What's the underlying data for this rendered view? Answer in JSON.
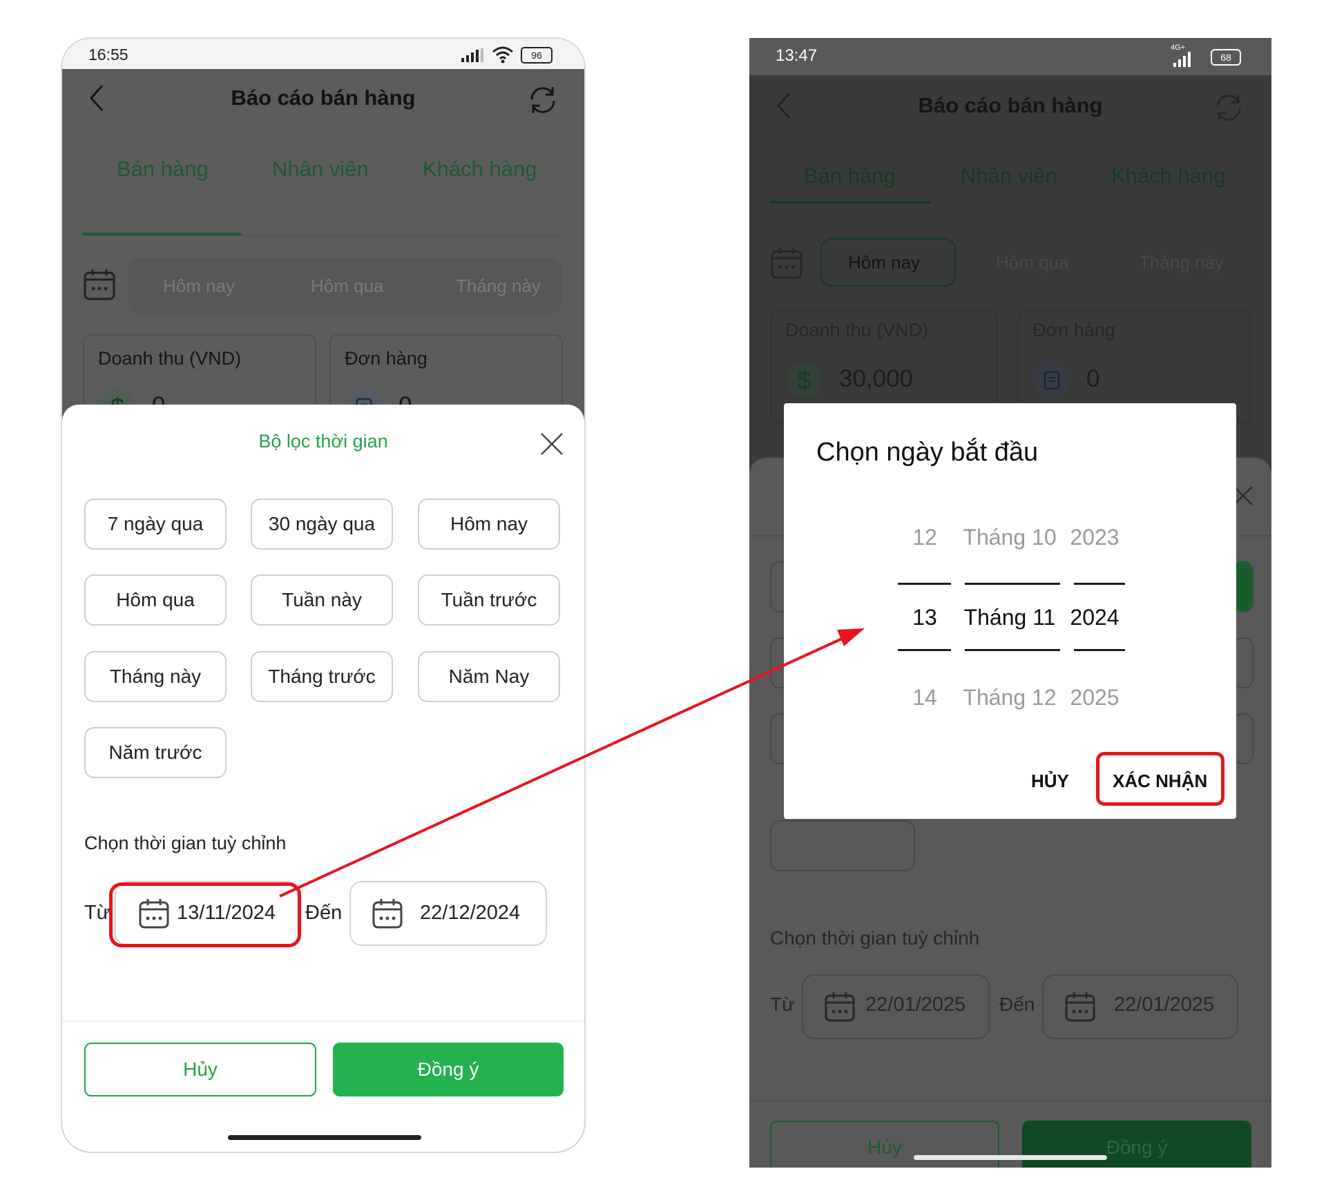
{
  "left_screen": {
    "status_bar": {
      "time": "16:55",
      "battery": "96"
    },
    "header": {
      "title": "Báo cáo bán hàng"
    },
    "tabs": [
      "Bán hàng",
      "Nhân viên",
      "Khách hàng"
    ],
    "quick_chips": [
      "Hôm nay",
      "Hôm qua",
      "Tháng này"
    ],
    "cards": [
      {
        "label": "Doanh thu (VND)",
        "value": "0"
      },
      {
        "label": "Đơn hàng",
        "value": "0"
      }
    ],
    "filter_sheet": {
      "title": "Bộ lọc thời gian",
      "presets": [
        "7 ngày qua",
        "30 ngày qua",
        "Hôm nay",
        "Hôm qua",
        "Tuần này",
        "Tuần trước",
        "Tháng này",
        "Tháng trước",
        "Năm Nay",
        "Năm trước"
      ],
      "custom_label": "Chọn thời gian tuỳ chỉnh",
      "from_label": "Từ",
      "from_date": "13/11/2024",
      "to_label": "Đến",
      "to_date": "22/12/2024",
      "cancel_label": "Hủy",
      "confirm_label": "Đồng ý"
    }
  },
  "right_screen": {
    "status_bar": {
      "time": "13:47",
      "battery": "68",
      "network": "4G+"
    },
    "header": {
      "title": "Báo cáo bán hàng"
    },
    "tabs": [
      "Bán hàng",
      "Nhân viên",
      "Khách hàng"
    ],
    "quick_chips": [
      "Hôm nay",
      "Hôm qua",
      "Tháng này"
    ],
    "cards": [
      {
        "label": "Doanh thu (VND)",
        "value": "30,000"
      },
      {
        "label": "Đơn hàng",
        "value": "0"
      }
    ],
    "filter_sheet": {
      "custom_label": "Chọn thời gian tuỳ chỉnh",
      "from_label": "Từ",
      "from_date": "22/01/2025",
      "to_label": "Đến",
      "to_date": "22/01/2025",
      "cancel_label": "Hủy",
      "confirm_label": "Đồng ý"
    },
    "date_dialog": {
      "title": "Chọn ngày bắt đầu",
      "day": {
        "prev": "12",
        "selected": "13",
        "next": "14"
      },
      "month": {
        "prev": "Tháng 10",
        "selected": "Tháng 11",
        "next": "Tháng 12"
      },
      "year": {
        "prev": "2023",
        "selected": "2024",
        "next": "2025"
      },
      "cancel_label": "HỦY",
      "confirm_label": "XÁC NHẬN"
    }
  },
  "colors": {
    "accent": "#24b14d",
    "highlight": "#e8141c"
  }
}
